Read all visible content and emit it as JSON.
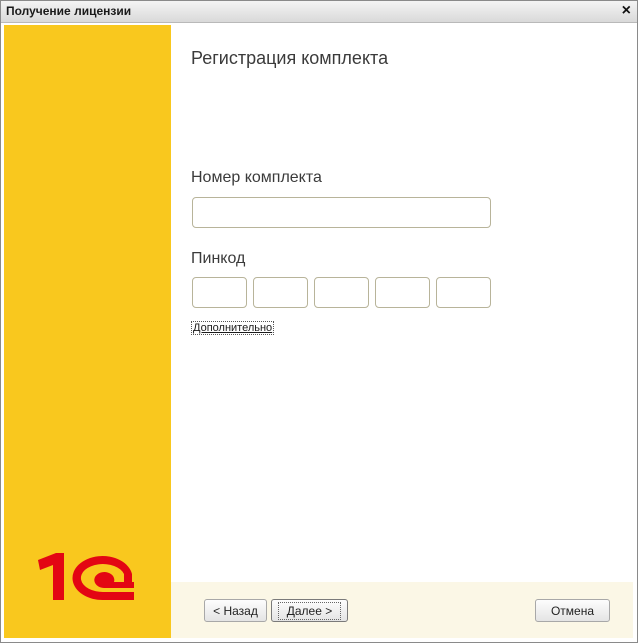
{
  "window": {
    "title": "Получение лицензии",
    "close_glyph": "×"
  },
  "brand": {
    "logo": "1С",
    "logo_color": "#e30613",
    "sidebar_color": "#f9c81e"
  },
  "form": {
    "heading": "Регистрация комплекта",
    "number_label": "Номер комплекта",
    "number_value": "",
    "pin_label": "Пинкод",
    "pin_values": [
      "",
      "",
      "",
      "",
      ""
    ],
    "more_link": "Дополнительно"
  },
  "footer": {
    "back_label": "< Назад",
    "next_label": "Далее >",
    "cancel_label": "Отмена"
  }
}
